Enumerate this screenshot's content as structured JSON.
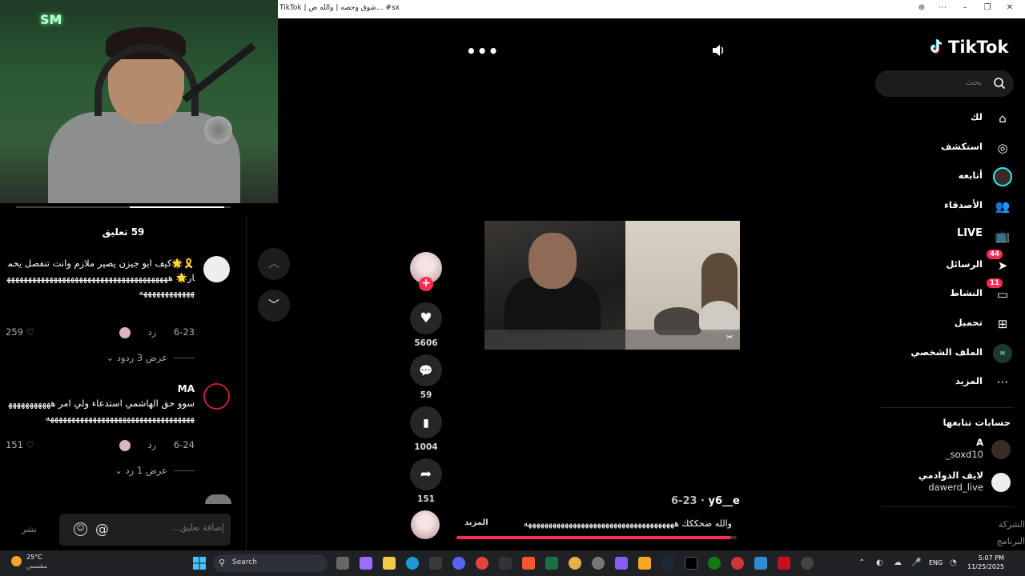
{
  "window": {
    "title": "TikTok | شوق وحصه | والله ض... #sx",
    "controls": [
      "zoom-icon",
      "more-icon",
      "minimize-icon",
      "restore-icon",
      "close-icon"
    ]
  },
  "webcam": {
    "neon_text": "SM"
  },
  "comments": {
    "count_label": "59 تعليق",
    "items": [
      {
        "user": "",
        "text": "🎗️🌟كيف ابو جيزن يصير ملازم وانت تنفصل يحمار🌟 هههههههههههههههههههههههههههههههههههههههههههههههههههه",
        "date": "6-23",
        "reply": "رد",
        "likes": "259",
        "view_replies": "عرض 3 ردود"
      },
      {
        "user": "MA",
        "text": "سوو حق الهاشمي استدعاء ولي امر هههههههههههههههههههههههههههههههههههههههههههههه",
        "date": "6-24",
        "reply": "رد",
        "likes": "151",
        "view_replies": "عرض 1 رد"
      }
    ],
    "input_placeholder": "إضافة تعليق...",
    "at_symbol": "@",
    "post_label": "نشر"
  },
  "player": {
    "more": "•••",
    "likes": "5606",
    "comments": "59",
    "saves": "1004",
    "shares": "151",
    "caption_user": "y6__e",
    "caption_date": "6-23 · ",
    "caption_text": "والله ضحككك هههههههههههههههههههههههههههههههههههههه",
    "caption_more": "المزيد",
    "progress": 0.98,
    "watermark": "✂"
  },
  "sidebar": {
    "logo": "TikTok",
    "search_placeholder": "بحث",
    "items": [
      {
        "label": "لك",
        "icon": "home-icon"
      },
      {
        "label": "استكشف",
        "icon": "compass-icon"
      },
      {
        "label": "أتابعه",
        "icon": "following-avatar-icon"
      },
      {
        "label": "الأصدقاء",
        "icon": "friends-icon"
      },
      {
        "label": "LIVE",
        "icon": "live-icon"
      },
      {
        "label": "الرسائل",
        "icon": "messages-icon",
        "badge": "44"
      },
      {
        "label": "النشاط",
        "icon": "activity-icon",
        "badge": "11"
      },
      {
        "label": "تحميل",
        "icon": "upload-icon"
      },
      {
        "label": "الملف الشخصي",
        "icon": "profile-icon"
      },
      {
        "label": "المزيد",
        "icon": "more-icon"
      }
    ],
    "following_title": "حسابات تتابعها",
    "accounts": [
      {
        "name": "A",
        "handle": "_soxd10"
      },
      {
        "name": "لايف الدوادمي",
        "handle": "dawerd_live"
      }
    ],
    "footer": [
      "الشركة",
      "البرنامج"
    ]
  },
  "taskbar": {
    "temp": "25°C",
    "weather": "مشمس",
    "search": "Search",
    "lang": "ENG",
    "time": "5:07 PM",
    "date": "11/25/2025"
  }
}
